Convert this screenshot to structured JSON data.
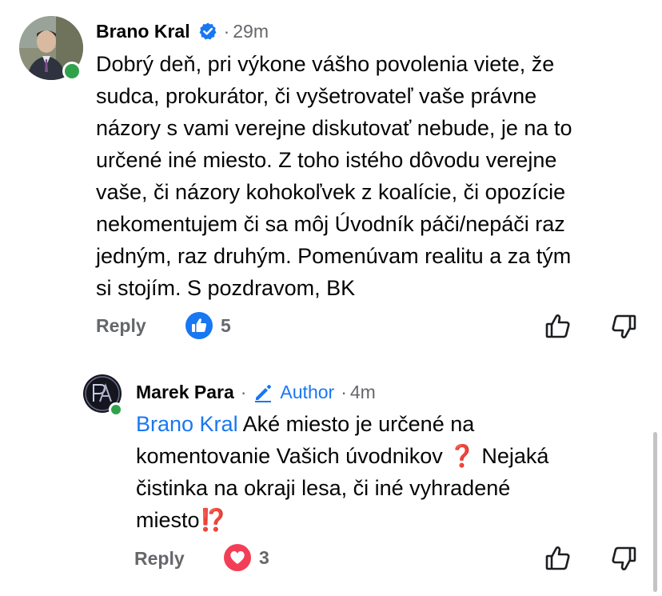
{
  "comments": [
    {
      "author": "Brano Kral",
      "verified": true,
      "separator": "·",
      "time": "29m",
      "text_lines": [
        "Dobrý deň, pri výkone vášho povolenia viete, že",
        "sudca, prokurátor, či vyšetrovateľ vaše právne",
        "názory s vami verejne diskutovať nebude, je na to",
        "určené iné miesto. Z toho istého dôvodu verejne",
        "vaše, či názory kohokoľvek z koalície, či opozície",
        "nekomentujem či sa môj Úvodník páči/nepáči raz",
        "jedným, raz druhým. Pomenúvam realitu a za tým",
        "si stojím. S pozdravom, BK"
      ],
      "reply_label": "Reply",
      "reaction": {
        "icon": "like-icon",
        "count": "5",
        "color": "#1877f2"
      }
    },
    {
      "author": "Marek Para",
      "separator": "·",
      "badge": "Author",
      "badge_separator": "·",
      "time": "4m",
      "mention": "Brano Kral",
      "text_lines": [
        " Aké miesto je určené na",
        "komentovanie Vašich úvodnikov ",
        " Nejaká",
        "čistinka na okraji lesa, či iné vyhradené",
        "miesto"
      ],
      "emojis": [
        "❓",
        "⁉️"
      ],
      "reply_label": "Reply",
      "reaction": {
        "icon": "love-icon",
        "count": "3",
        "color": "#f33e58"
      }
    }
  ],
  "colors": {
    "mention": "#1877f2",
    "online": "#31a24c",
    "meta": "#65676b"
  }
}
